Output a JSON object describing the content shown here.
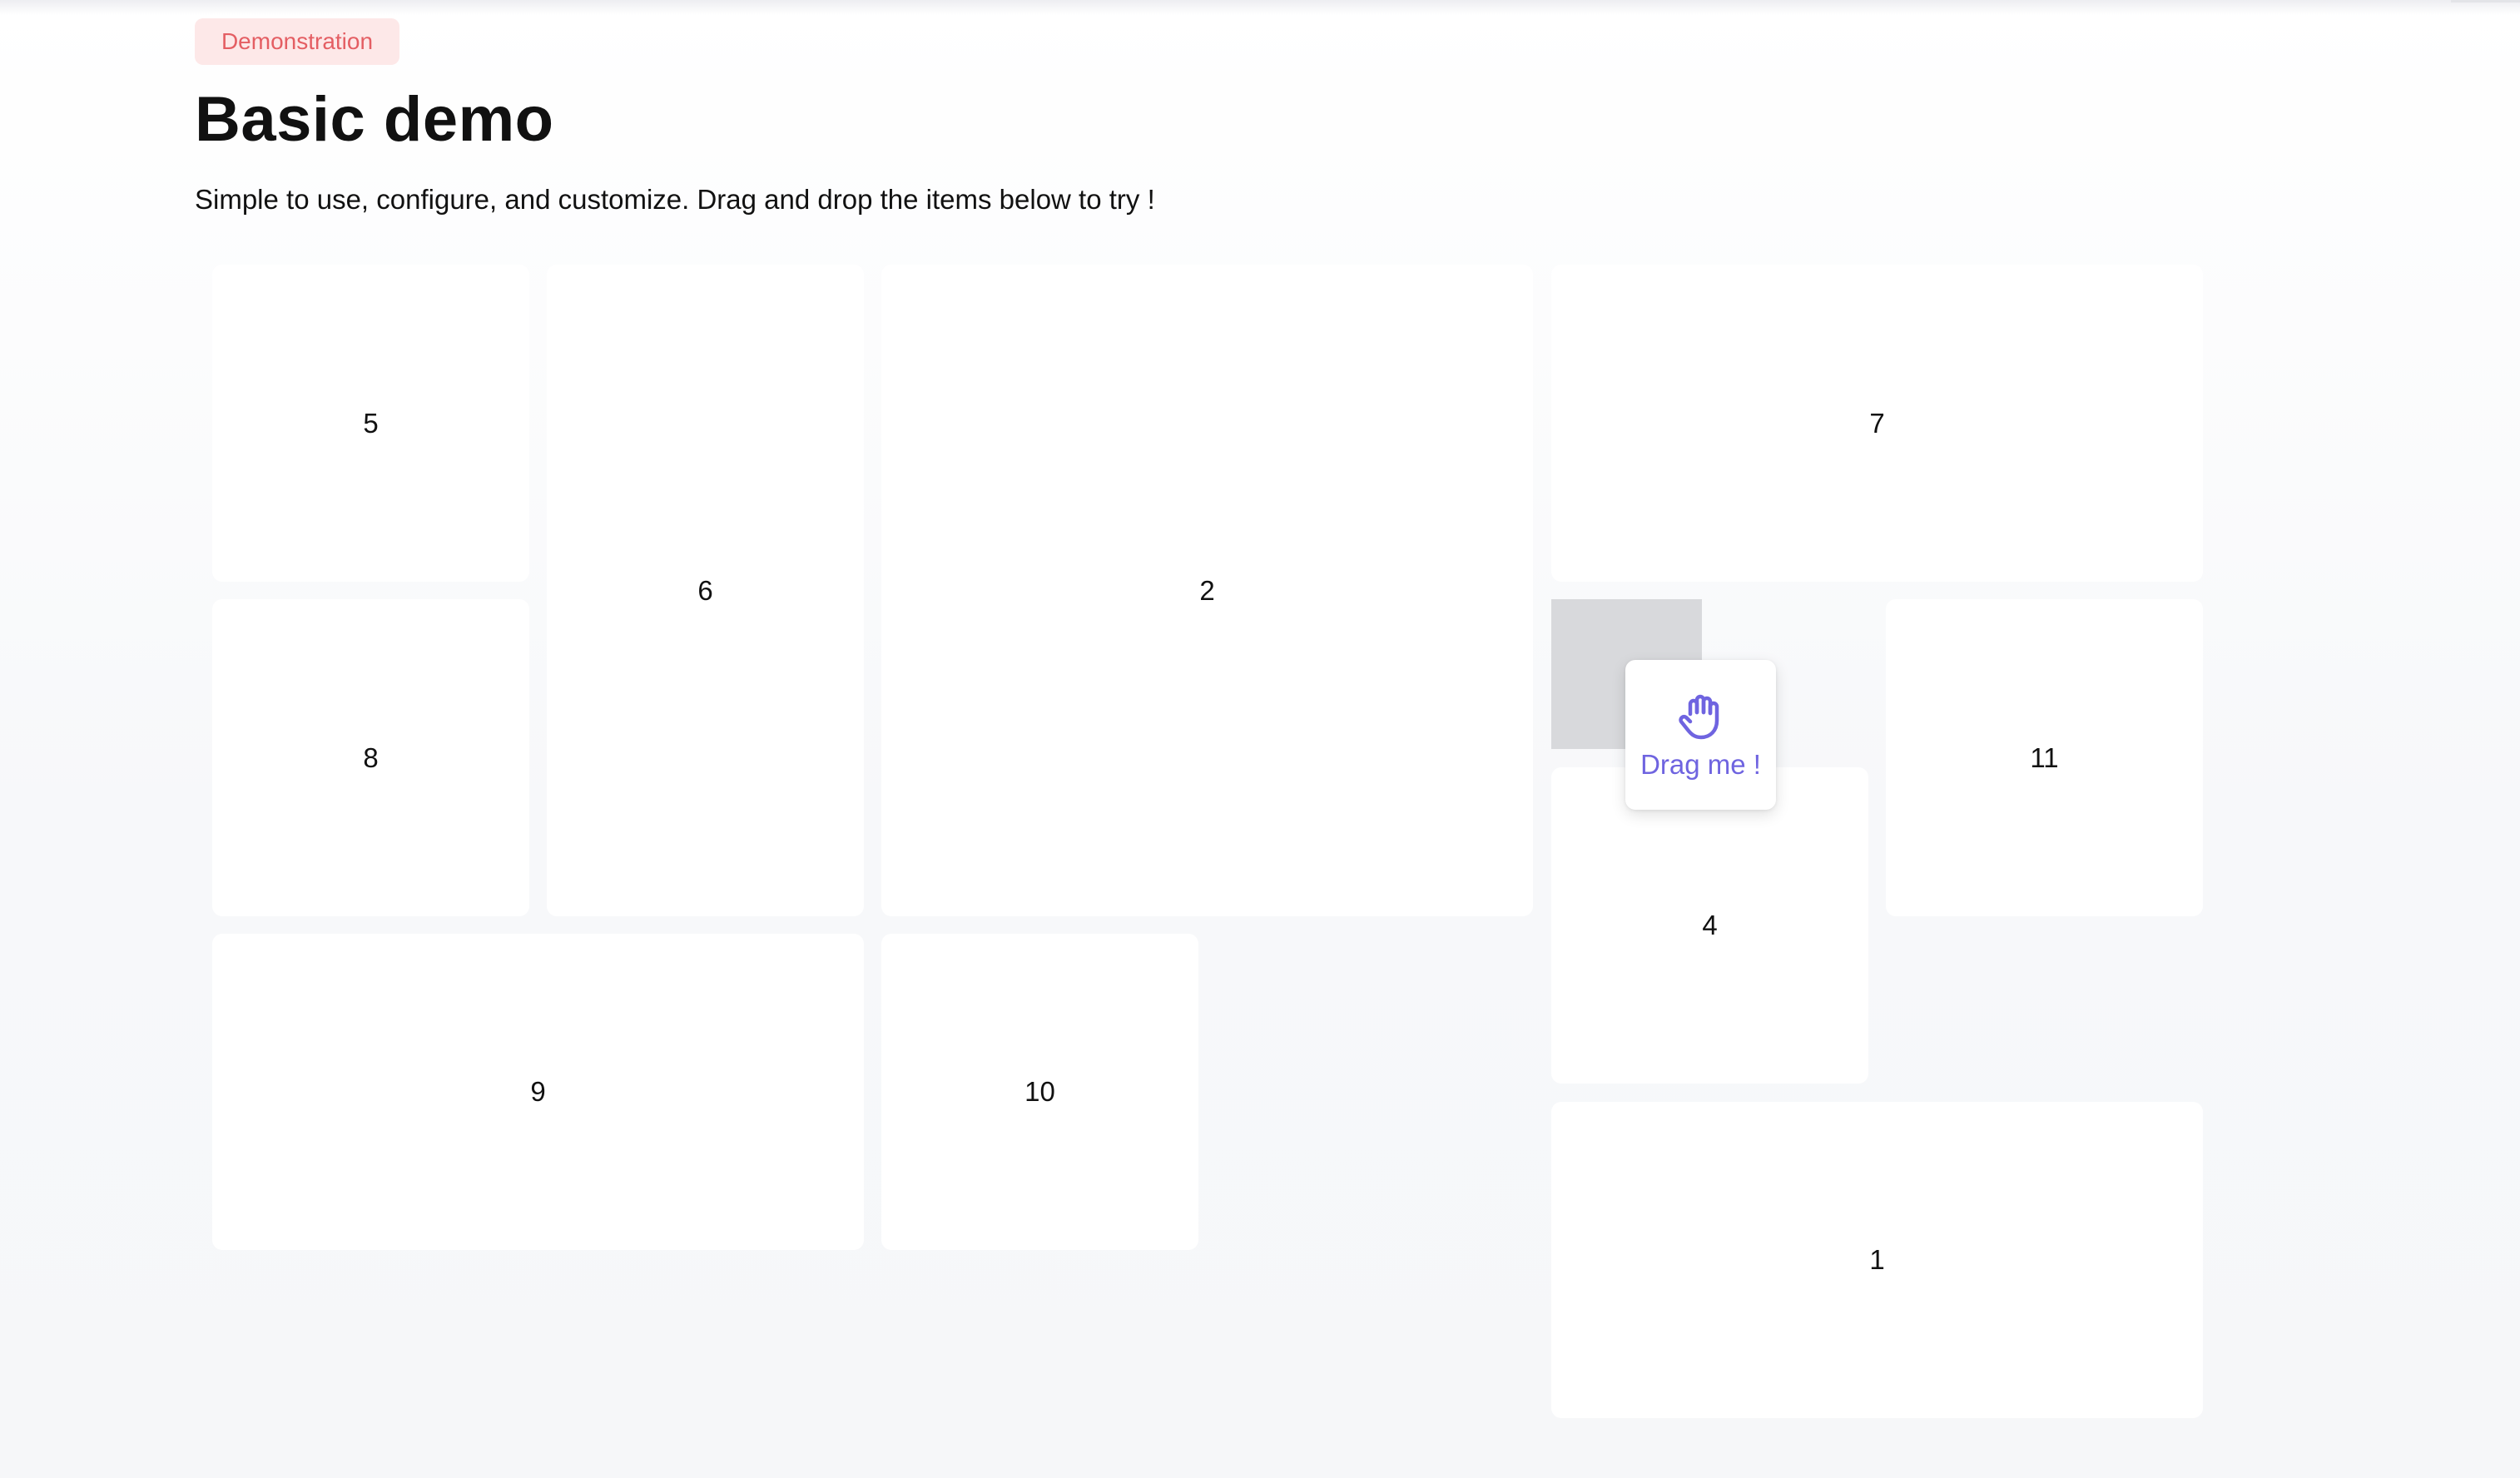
{
  "header": {
    "badge": "Demonstration",
    "title": "Basic demo",
    "subtitle": "Simple to use, configure, and customize. Drag and drop the items below to try !"
  },
  "grid": {
    "items": [
      {
        "label": "5"
      },
      {
        "label": "6"
      },
      {
        "label": "2"
      },
      {
        "label": "7"
      },
      {
        "label": "8"
      },
      {
        "label": "11"
      },
      {
        "label": "4"
      },
      {
        "label": "9"
      },
      {
        "label": "10"
      },
      {
        "label": "1"
      }
    ],
    "dragging": {
      "label": "Drag me !",
      "icon": "hand-icon"
    }
  },
  "colors": {
    "accent": "#6f64e0",
    "badge_text": "#e45e63",
    "badge_bg": "#fde8e8",
    "placeholder": "#d8d9dc"
  }
}
